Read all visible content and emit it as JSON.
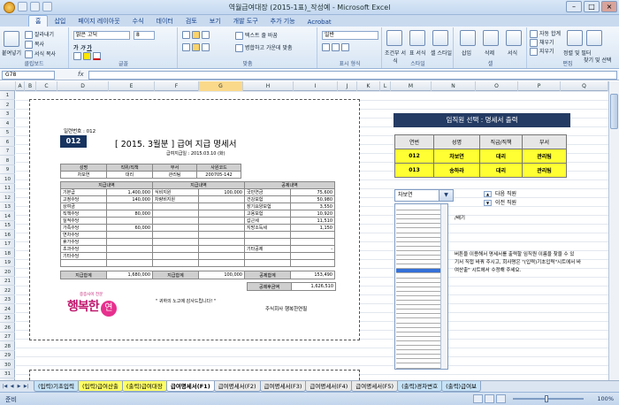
{
  "window": {
    "title": "역월급여대장 (2015-1표)_작성예 - Microsoft Excel",
    "controls": [
      "–",
      "□",
      "×"
    ]
  },
  "ribbon_tabs": [
    "홈",
    "삽입",
    "페이지 레이아웃",
    "수식",
    "데이터",
    "검토",
    "보기",
    "개발 도구",
    "추가 기능",
    "Acrobat"
  ],
  "ribbon": {
    "clipboard": {
      "paste": "붙여넣기",
      "cut": "잘라내기",
      "copy": "복사",
      "format_painter": "서식 복사",
      "label": "클립보드"
    },
    "font": {
      "name": "맑은 고딕",
      "size": "8",
      "label": "글꼴"
    },
    "align": {
      "wrap": "텍스트 줄 바꿈",
      "merge": "병합하고 가운데 맞춤",
      "label": "맞춤"
    },
    "number": {
      "format": "일반",
      "label": "표시 형식"
    },
    "styles": {
      "cond": "조건부 서식",
      "table": "표 서식",
      "cell": "셀 스타일",
      "label": "스타일"
    },
    "cells": {
      "insert": "삽입",
      "delete": "삭제",
      "format": "서식",
      "label": "셀"
    },
    "editing": {
      "autosum": "자동 합계",
      "fill": "채우기",
      "clear": "지우기",
      "sort": "정렬 및 필터",
      "find": "찾기 및 선택",
      "label": "편집"
    }
  },
  "formula_bar": {
    "name_box": "G78",
    "fx": "fx",
    "value": ""
  },
  "columns": [
    "A",
    "B",
    "C",
    "D",
    "E",
    "F",
    "G",
    "H",
    "I",
    "J",
    "K",
    "L",
    "M",
    "N",
    "O",
    "P",
    "Q"
  ],
  "rows": [
    "1",
    "2",
    "3",
    "4",
    "5",
    "6",
    "7",
    "8",
    "9",
    "10",
    "11",
    "12",
    "13",
    "14",
    "15",
    "16",
    "17",
    "18",
    "19",
    "20",
    "21",
    "22",
    "23",
    "24",
    "25",
    "26",
    "27",
    "28",
    "29",
    "30",
    "31"
  ],
  "payslip": {
    "issue_no": "일련번호 : 012",
    "badge": "012",
    "title": "[ 2015. 3월분 ]  급여 지급 명세서",
    "pay_date": "급여지급일 : 2015.03.10 (화)",
    "emp_headers": [
      "성명",
      "직위/직책",
      "부서",
      "사원코드"
    ],
    "emp_values": [
      "차보연",
      "대리",
      "관리팀",
      "200705-142"
    ],
    "section_headers": [
      "지급내역",
      "지급내역",
      "공제내역"
    ],
    "rows": [
      [
        "기본급",
        "1,400,000",
        "식비지원",
        "100,000",
        "국민연금",
        "75,600"
      ],
      [
        "고정수당",
        "140,000",
        "차량비지원",
        "",
        "건강보험",
        "50,980"
      ],
      [
        "상여금",
        "",
        "",
        "",
        "장기요양보험",
        "3,550"
      ],
      [
        "직책수당",
        "80,000",
        "",
        "",
        "고용보험",
        "10,920"
      ],
      [
        "실적수당",
        "",
        "",
        "",
        "갑근세",
        "11,510"
      ],
      [
        "가족수당",
        "60,000",
        "",
        "",
        "지방소득세",
        "1,150"
      ],
      [
        "연차수당",
        "",
        "",
        "",
        "",
        ""
      ],
      [
        "휴가수당",
        "",
        "",
        "",
        "",
        ""
      ],
      [
        "초과수당",
        "",
        "",
        "",
        "기타공제",
        "-"
      ],
      [
        "기타수당",
        "",
        "",
        "",
        "",
        ""
      ],
      [
        "",
        "",
        "",
        "",
        "",
        ""
      ]
    ],
    "totals": [
      "지급합계",
      "1,680,000",
      "지급합계",
      "100,000",
      "공제합계",
      "153,490"
    ],
    "net": [
      "공제후금액",
      "1,626,510"
    ],
    "logo_small": "중증사이 전문",
    "logo_main": "행복한",
    "logo_stamp": "연",
    "thanks": "\" 귀하의 노고에 감사드립니다! \"",
    "company": "주식회사 행복한연필"
  },
  "selector": {
    "header": "임직원 선택 : 명세서 출력",
    "columns": [
      "연번",
      "성명",
      "직급/직책",
      "부서"
    ],
    "rows": [
      [
        "012",
        "차보연",
        "대리",
        "관리팀"
      ],
      [
        "013",
        "송하라",
        "대리",
        "관리팀"
      ]
    ],
    "dropdown_value": "차보연",
    "next": "다음 직원",
    "prev": "이전 직원",
    "desc1": "/배기",
    "desc2": "버튼을 이용해서 명세서를 출력할 임직원 이름을 찾을 수 있",
    "desc3": "기서 직접 바꿔 주시고, 회사명은 \"(입력)기초입력\"시트에서 바",
    "desc4": "여산출\" 시트에서 수정해 주세요."
  },
  "sheet_tabs": [
    "(입력)기초입력",
    "(입력)급여산출",
    "(출력)급여대장",
    "급여명세서(F1)",
    "급여명세서(F2)",
    "급여명세서(F3)",
    "급여명세서(F4)",
    "급여명세서(F5)",
    "(출력)경차변호",
    "(출력)급여보"
  ],
  "status": {
    "ready": "준비",
    "zoom": "100%"
  }
}
